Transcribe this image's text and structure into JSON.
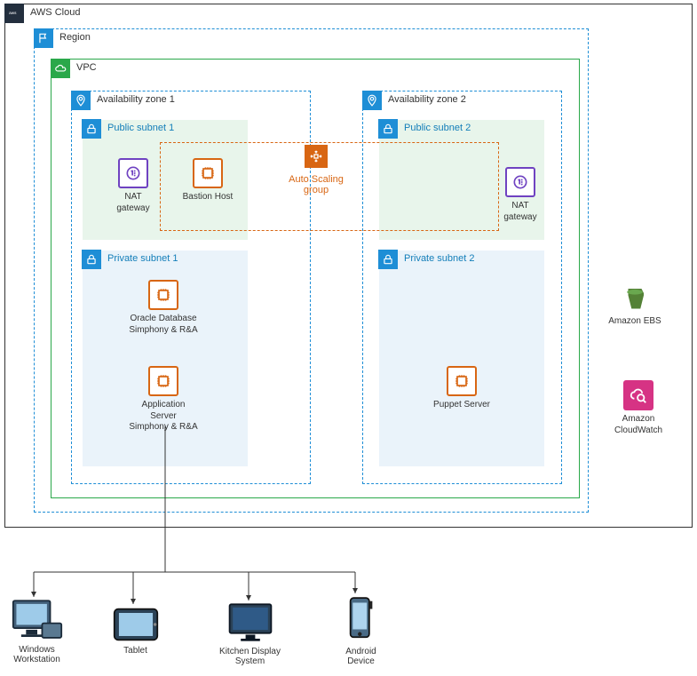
{
  "cloud": {
    "label": "AWS Cloud"
  },
  "region": {
    "label": "Region"
  },
  "vpc": {
    "label": "VPC"
  },
  "az": {
    "a": "Availability zone 1",
    "b": "Availability zone 2"
  },
  "subnets": {
    "pub1": "Public subnet 1",
    "pub2": "Public subnet 2",
    "pri1": "Private subnet 1",
    "pri2": "Private subnet 2"
  },
  "asg": {
    "label": "Auto Scaling group"
  },
  "resources": {
    "nat": "NAT\ngateway",
    "bastion": "Bastion Host",
    "db": "Oracle Database\nSimphony & R&A",
    "app": "Application Server\nSimphony & R&A",
    "puppet": "Puppet Server"
  },
  "outside": {
    "ebs": "Amazon EBS",
    "cloudwatch": "Amazon\nCloudWatch"
  },
  "devices": {
    "win": "Windows\nWorkstation",
    "tablet": "Tablet",
    "kds": "Kitchen Display\nSystem",
    "android": "Android\nDevice"
  },
  "icons": {
    "aws": "aws-logo",
    "flag": "flag-icon",
    "cloud": "cloud-outline-icon",
    "pin": "map-pin-icon",
    "lock": "lock-icon",
    "asg": "autoscale-icon",
    "nat": "nat-gateway-icon",
    "ec2": "ec2-instance-icon",
    "ebs": "ebs-bucket-icon",
    "cw": "cloudwatch-icon",
    "monitor": "monitor-icon",
    "tablet": "tablet-icon",
    "phone": "phone-icon"
  }
}
